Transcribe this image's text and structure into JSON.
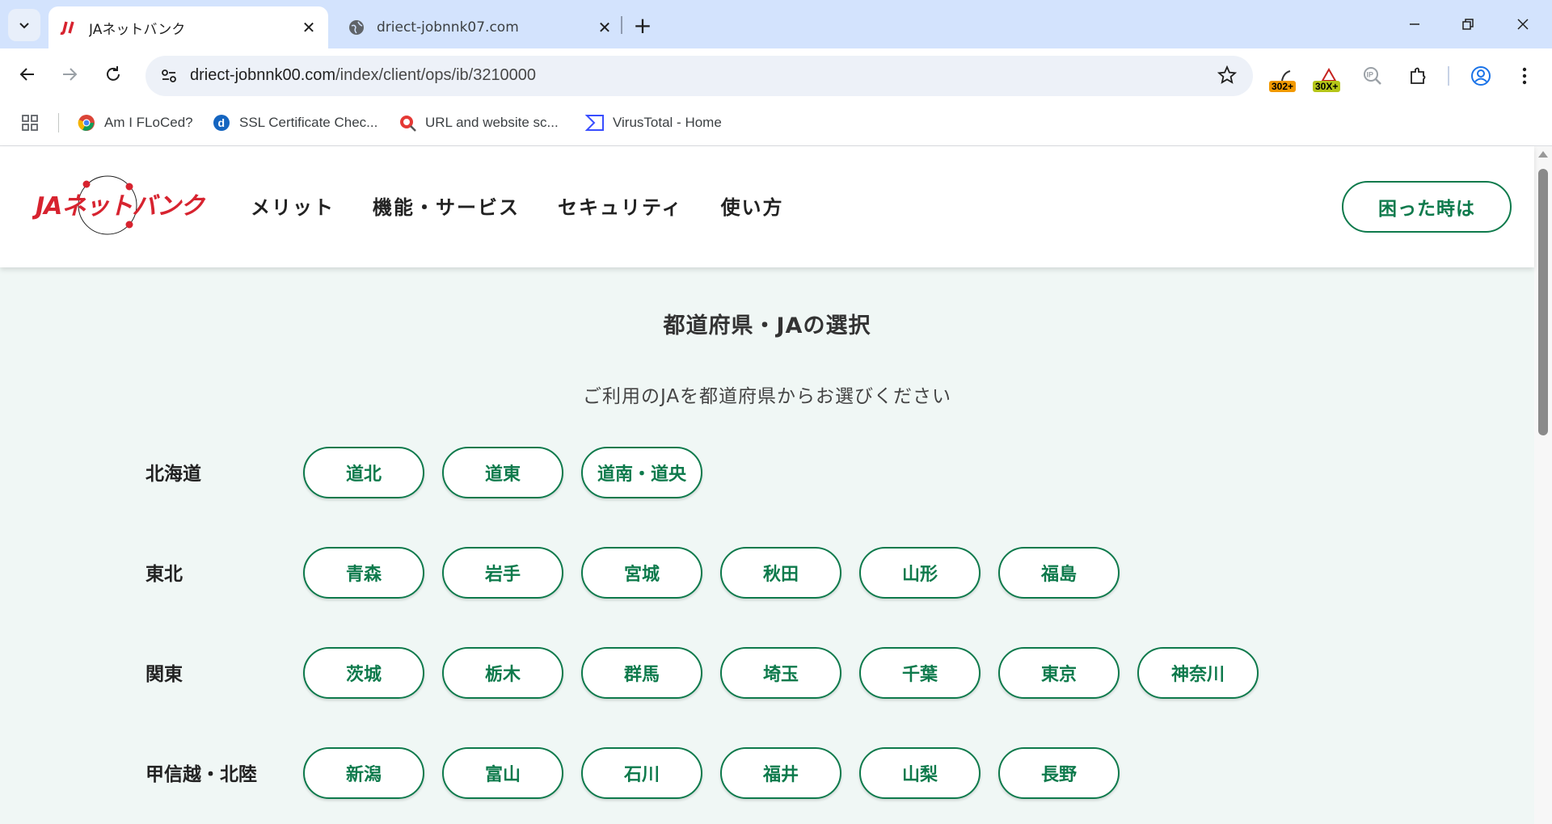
{
  "browser": {
    "tabs": [
      {
        "title": "JAネットバンク",
        "active": true
      },
      {
        "title": "driect-jobnnk07.com",
        "active": false
      }
    ],
    "url_host": "driect-jobnnk00.com",
    "url_path": "/index/client/ops/ib/3210000",
    "extensions": {
      "redirect_badge": "302+",
      "status_badge": "30X+"
    },
    "bookmarks": [
      {
        "label": "Am I FLoCed?",
        "icon": "chrome-icon"
      },
      {
        "label": "SSL Certificate Chec...",
        "icon": "d-icon"
      },
      {
        "label": "URL and website sc...",
        "icon": "urlscan-icon"
      },
      {
        "label": "VirusTotal - Home",
        "icon": "virustotal-icon"
      }
    ]
  },
  "site": {
    "logo_text": "JAネットバンク",
    "nav": [
      "メリット",
      "機能・サービス",
      "セキュリティ",
      "使い方"
    ],
    "help_button": "困った時は",
    "page_title": "都道府県・JAの選択",
    "page_subtitle": "ご利用のJAを都道府県からお選びください",
    "regions": [
      {
        "name": "北海道",
        "prefectures": [
          "道北",
          "道東",
          "道南・道央"
        ]
      },
      {
        "name": "東北",
        "prefectures": [
          "青森",
          "岩手",
          "宮城",
          "秋田",
          "山形",
          "福島"
        ]
      },
      {
        "name": "関東",
        "prefectures": [
          "茨城",
          "栃木",
          "群馬",
          "埼玉",
          "千葉",
          "東京",
          "神奈川"
        ]
      },
      {
        "name": "甲信越・北陸",
        "prefectures": [
          "新潟",
          "富山",
          "石川",
          "福井",
          "山梨",
          "長野"
        ]
      }
    ]
  },
  "colors": {
    "accent_green": "#0e7a4c",
    "logo_red": "#d7232f",
    "tabstrip": "#d3e3fd"
  }
}
